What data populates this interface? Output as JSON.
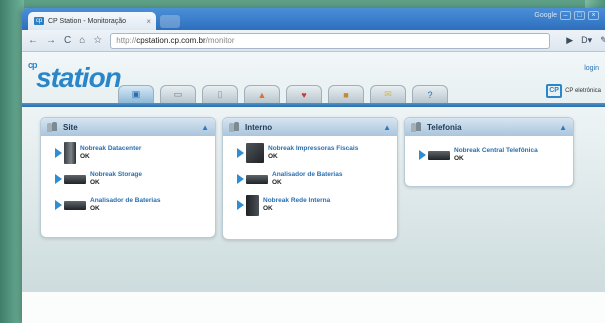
{
  "browser": {
    "tab_title": "CP Station - Monitoração",
    "tab_close": "×",
    "url_prefix": "http://",
    "url_host": "cpstation.cp.com.br",
    "url_path": "/monitor",
    "window_label": "Google"
  },
  "app": {
    "logo_sup": "cp",
    "logo": "station",
    "login": "login",
    "brand": "CP eletrônica",
    "brand_mark": "CP"
  },
  "panels": [
    {
      "title": "Site",
      "items": [
        {
          "name": "Nobreak Datacenter",
          "status": "OK"
        },
        {
          "name": "Nobreak Storage",
          "status": "OK"
        },
        {
          "name": "Analisador de Baterias",
          "status": "OK"
        }
      ]
    },
    {
      "title": "Interno",
      "items": [
        {
          "name": "Nobreak Impressoras Fiscais",
          "status": "OK"
        },
        {
          "name": "Analisador de Baterias",
          "status": "OK"
        },
        {
          "name": "Nobreak Rede Interna",
          "status": "OK"
        }
      ]
    },
    {
      "title": "Telefonia",
      "items": [
        {
          "name": "Nobreak Central Telefônica",
          "status": "OK"
        }
      ]
    }
  ]
}
